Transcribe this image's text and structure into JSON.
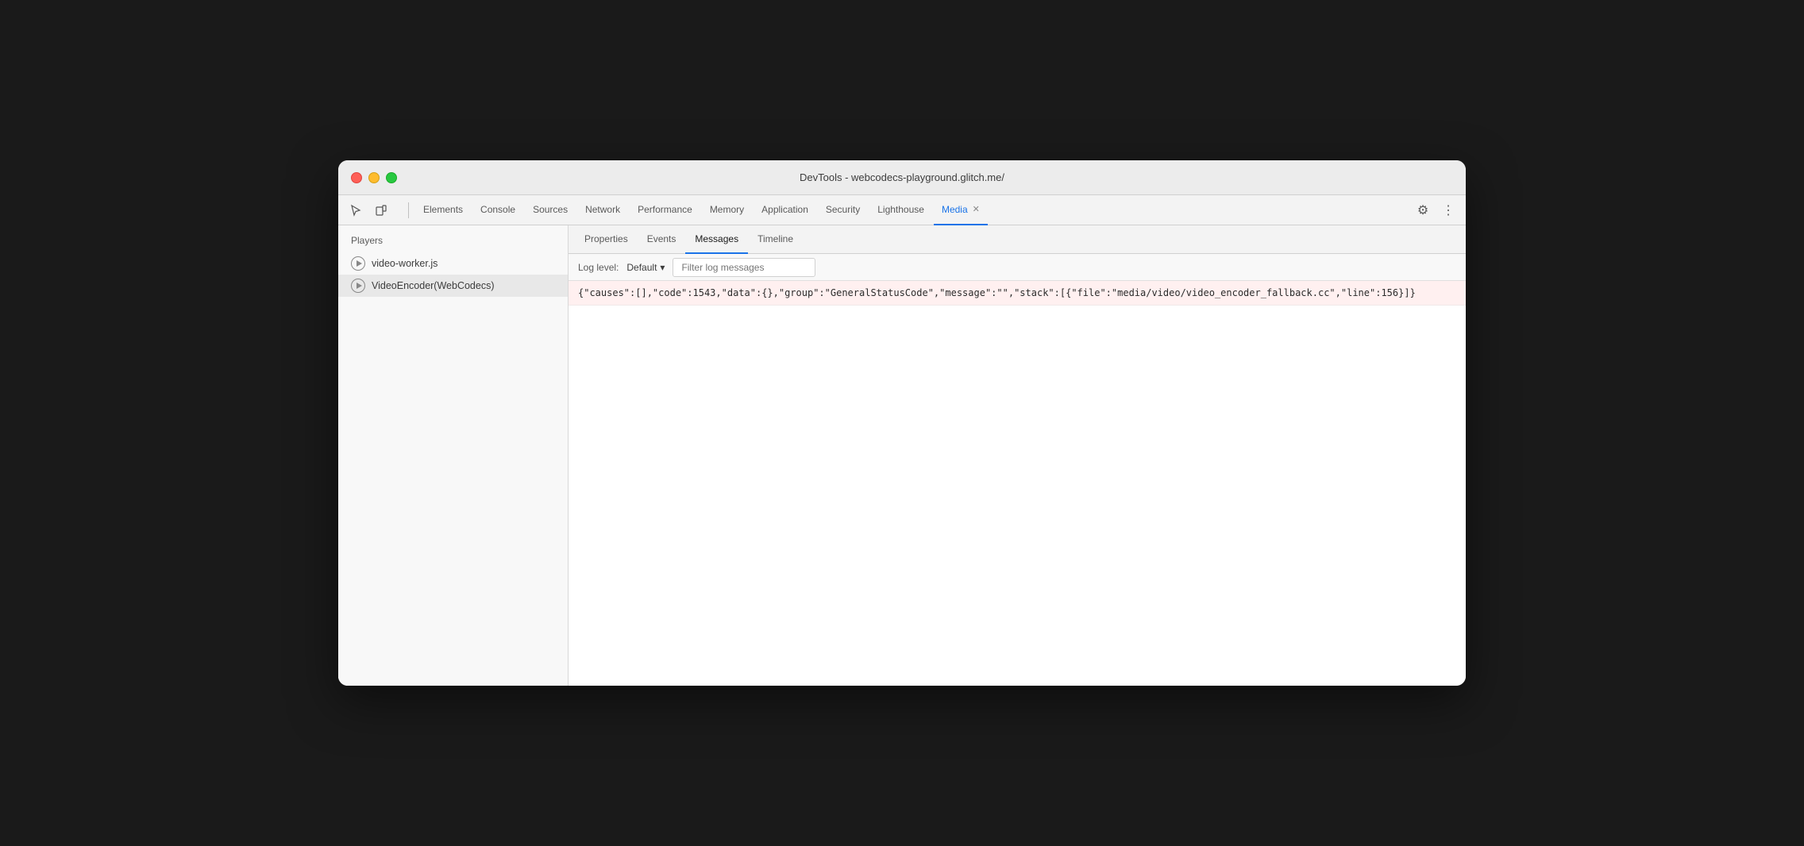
{
  "window": {
    "title": "DevTools - webcodecs-playground.glitch.me/"
  },
  "toolbar": {
    "tabs": [
      {
        "id": "elements",
        "label": "Elements",
        "active": false
      },
      {
        "id": "console",
        "label": "Console",
        "active": false
      },
      {
        "id": "sources",
        "label": "Sources",
        "active": false
      },
      {
        "id": "network",
        "label": "Network",
        "active": false
      },
      {
        "id": "performance",
        "label": "Performance",
        "active": false
      },
      {
        "id": "memory",
        "label": "Memory",
        "active": false
      },
      {
        "id": "application",
        "label": "Application",
        "active": false
      },
      {
        "id": "security",
        "label": "Security",
        "active": false
      },
      {
        "id": "lighthouse",
        "label": "Lighthouse",
        "active": false
      },
      {
        "id": "media",
        "label": "Media",
        "active": true,
        "closeable": true
      }
    ]
  },
  "sidebar": {
    "header": "Players",
    "items": [
      {
        "id": "video-worker",
        "label": "video-worker.js",
        "selected": false
      },
      {
        "id": "video-encoder",
        "label": "VideoEncoder(WebCodecs)",
        "selected": true
      }
    ]
  },
  "panel": {
    "tabs": [
      {
        "id": "properties",
        "label": "Properties",
        "active": false
      },
      {
        "id": "events",
        "label": "Events",
        "active": false
      },
      {
        "id": "messages",
        "label": "Messages",
        "active": true
      },
      {
        "id": "timeline",
        "label": "Timeline",
        "active": false
      }
    ],
    "log_toolbar": {
      "level_label": "Log level:",
      "level_value": "Default",
      "filter_placeholder": "Filter log messages"
    },
    "log_entries": [
      {
        "type": "error",
        "text": "{\"causes\":[],\"code\":1543,\"data\":{},\"group\":\"GeneralStatusCode\",\"message\":\"\",\"stack\":[{\"file\":\"media/video/video_encoder_fallback.cc\",\"line\":156}]}"
      }
    ]
  },
  "icons": {
    "cursor": "⬚",
    "layers": "◫",
    "gear": "⚙",
    "more": "⋮",
    "dropdown_arrow": "▾"
  }
}
